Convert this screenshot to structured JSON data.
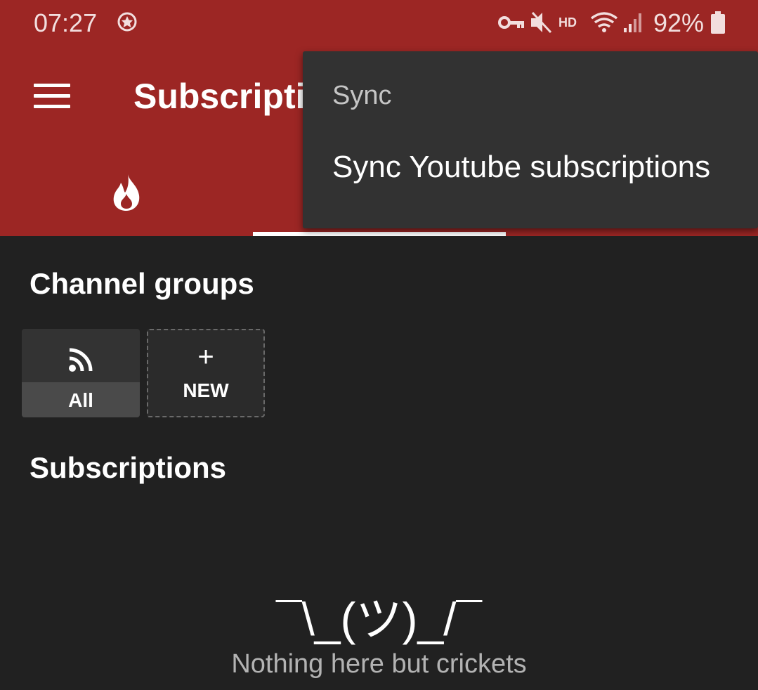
{
  "status_bar": {
    "time": "07:27",
    "battery": "92%",
    "icons": [
      "notification-icon",
      "vpn-key-icon",
      "mute-icon",
      "hd-icon",
      "wifi-icon",
      "signal-icon",
      "battery-icon"
    ],
    "hd_label": "HD"
  },
  "toolbar": {
    "menu_icon": "hamburger-icon",
    "title": "Subscriptions",
    "color": "#9c2624"
  },
  "tabs": [
    {
      "icon": "fire-icon"
    }
  ],
  "overflow_menu": {
    "header": "Sync",
    "items": [
      "Sync Youtube subscriptions"
    ]
  },
  "channel_groups": {
    "title": "Channel groups",
    "groups": [
      {
        "label": "All",
        "icon": "rss-icon"
      },
      {
        "label": "NEW",
        "icon": "plus-icon",
        "plus": "+"
      }
    ]
  },
  "subscriptions": {
    "title": "Subscriptions",
    "empty_emoji": "¯\\_(ツ)_/¯",
    "empty_text": "Nothing here but crickets"
  }
}
